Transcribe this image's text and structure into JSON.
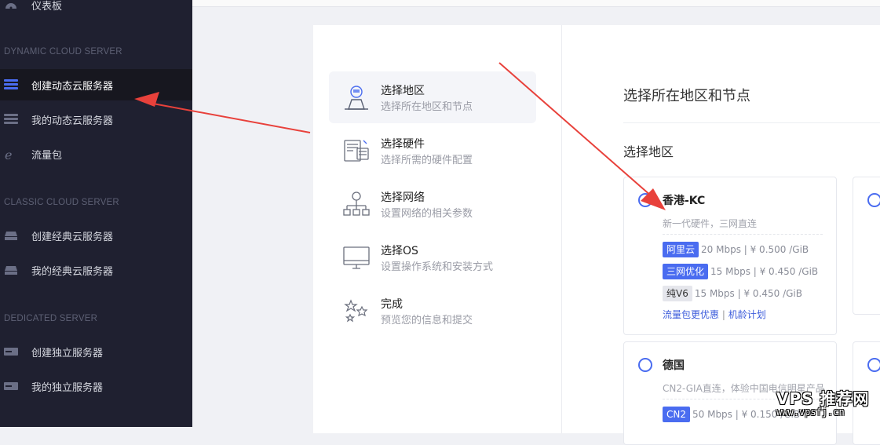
{
  "sidebar": {
    "dashboard": "仪表板",
    "sections": [
      {
        "title": "DYNAMIC CLOUD SERVER",
        "items": [
          "创建动态云服务器",
          "我的动态云服务器",
          "流量包"
        ]
      },
      {
        "title": "CLASSIC CLOUD SERVER",
        "items": [
          "创建经典云服务器",
          "我的经典云服务器"
        ]
      },
      {
        "title": "DEDICATED SERVER",
        "items": [
          "创建独立服务器",
          "我的独立服务器"
        ]
      }
    ],
    "accent": "#4a6cf0"
  },
  "steps": [
    {
      "title": "选择地区",
      "sub": "选择所在地区和节点",
      "icon": "location-person-icon"
    },
    {
      "title": "选择硬件",
      "sub": "选择所需的硬件配置",
      "icon": "hardware-icon"
    },
    {
      "title": "选择网络",
      "sub": "设置网络的相关参数",
      "icon": "network-icon"
    },
    {
      "title": "选择OS",
      "sub": "设置操作系统和安装方式",
      "icon": "monitor-icon"
    },
    {
      "title": "完成",
      "sub": "预览您的信息和提交",
      "icon": "stars-icon"
    }
  ],
  "panel": {
    "title": "选择所在地区和节点",
    "section": "选择地区"
  },
  "regions": [
    {
      "name": "香港-KC",
      "desc": "新一代硬件，三网直连",
      "lines": [
        {
          "badge": "阿里云",
          "style": "blue",
          "info": "20 Mbps | ¥ 0.500 /GiB"
        },
        {
          "badge": "三网优化",
          "style": "blue",
          "info": "15 Mbps | ¥ 0.450 /GiB"
        },
        {
          "badge": "纯V6",
          "style": "gray",
          "info": "15 Mbps | ¥ 0.450 /GiB"
        }
      ],
      "promo_a": "流量包更优惠",
      "promo_sep": "|",
      "promo_b": "机龄计划"
    },
    {
      "name": "德国",
      "desc": "CN2-GIA直连，体验中国电信明星产品",
      "lines": [
        {
          "badge": "CN2",
          "style": "blue",
          "info": "50 Mbps | ¥ 0.150 /GiB"
        }
      ]
    }
  ],
  "watermark": {
    "line1": "VPS 推荐网",
    "line2": "www.vpsfj.cn"
  }
}
